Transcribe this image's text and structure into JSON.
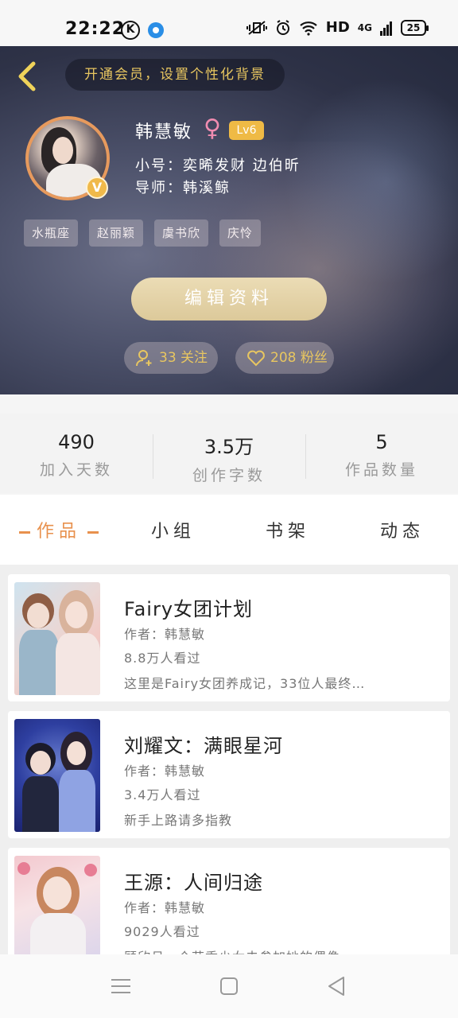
{
  "status_bar": {
    "time": "22:22",
    "k_label": "K",
    "network": "HD",
    "signal": "4G",
    "battery": "25"
  },
  "header": {
    "vip_banner": "开通会员，设置个性化背景",
    "name": "韩慧敏",
    "gender_symbol": "♀",
    "level": "Lv6",
    "alias": "小号：奕晞发财  边伯昕",
    "mentor": "导师：韩溪鲸",
    "verified_badge": "V",
    "tags": [
      "水瓶座",
      "赵丽颖",
      "虞书欣",
      "庆怜"
    ],
    "edit_button": "编辑资料",
    "follow_count": "33 关注",
    "fans_count": "208 粉丝"
  },
  "stats": [
    {
      "value": "490",
      "label": "加入天数"
    },
    {
      "value": "3.5万",
      "label": "创作字数"
    },
    {
      "value": "5",
      "label": "作品数量"
    }
  ],
  "tabs": [
    "作品",
    "小组",
    "书架",
    "动态"
  ],
  "works": [
    {
      "title": "Fairy女团计划",
      "author": "作者：韩慧敏",
      "views": "8.8万人看过",
      "desc": "这里是Fairy女团养成记，33位人最终…"
    },
    {
      "title": "刘耀文：满眼星河",
      "author": "作者：韩慧敏",
      "views": "3.4万人看过",
      "desc": "新手上路请多指教"
    },
    {
      "title": "王源：人间归途",
      "author": "作者：韩慧敏",
      "views": "9029人看过",
      "desc": "顾欣月一个花季少女去参加她的偶像…"
    }
  ],
  "colors": {
    "accent": "#e8914d",
    "gold": "#e8c660",
    "level_badge": "#efba45"
  }
}
